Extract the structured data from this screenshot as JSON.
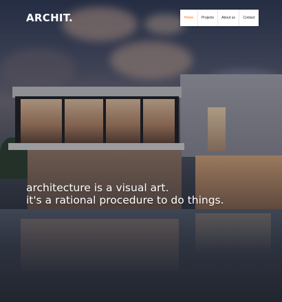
{
  "brand": {
    "logo": "ARCHIT."
  },
  "nav": {
    "items": [
      {
        "label": "Home",
        "active": true
      },
      {
        "label": "Projects",
        "active": false
      },
      {
        "label": "About us",
        "active": false
      },
      {
        "label": "Contact",
        "active": false
      }
    ],
    "active_color": "#f2761e"
  },
  "hero": {
    "headline_line1": "architecture is a visual art.",
    "headline_line2": "it's a rational procedure to do things."
  }
}
